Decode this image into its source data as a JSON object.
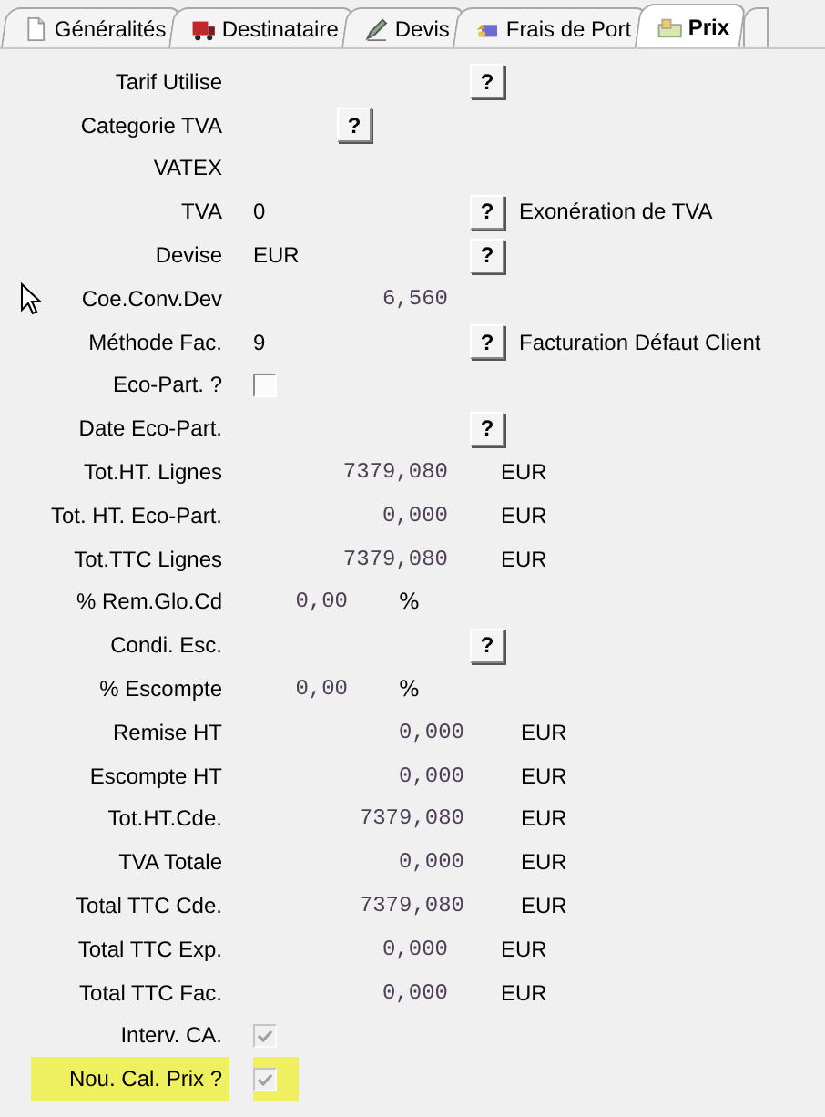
{
  "tabs": [
    {
      "label": "Généralités",
      "selected": false
    },
    {
      "label": "Destinataire",
      "selected": false
    },
    {
      "label": "Devis",
      "selected": false
    },
    {
      "label": "Frais de Port",
      "selected": false
    },
    {
      "label": "Prix",
      "selected": true
    }
  ],
  "fields": [
    {
      "label": "Tarif Utilise",
      "kind": "help",
      "help": "?"
    },
    {
      "label": "Categorie TVA",
      "kind": "help_inline",
      "help": "?"
    },
    {
      "label": "VATEX",
      "kind": "plain"
    },
    {
      "label": "TVA",
      "kind": "help",
      "value": "0",
      "help": "?",
      "description": "Exonération de TVA"
    },
    {
      "label": "Devise",
      "kind": "help",
      "value": "EUR",
      "help": "?"
    },
    {
      "label": "Coe.Conv.Dev",
      "kind": "amount",
      "value": "6,560"
    },
    {
      "label": "Méthode Fac.",
      "kind": "help",
      "value": "9",
      "help": "?",
      "description": "Facturation Défaut Client"
    },
    {
      "label": "Eco-Part. ?",
      "kind": "checkbox",
      "checked": false,
      "disabled": false,
      "highlighted": false
    },
    {
      "label": "Date Eco-Part.",
      "kind": "help",
      "help": "?"
    },
    {
      "label": "Tot.HT.  Lignes",
      "kind": "amount",
      "value": "7379,080",
      "unit": "EUR"
    },
    {
      "label": "Tot. HT. Eco-Part.",
      "kind": "amount",
      "value": "0,000",
      "unit": "EUR"
    },
    {
      "label": "Tot.TTC Lignes",
      "kind": "amount",
      "value": "7379,080",
      "unit": "EUR"
    },
    {
      "label": "% Rem.Glo.Cd",
      "kind": "percent",
      "value": "0,00",
      "unit": "%"
    },
    {
      "label": "Condi. Esc.",
      "kind": "help",
      "help": "?"
    },
    {
      "label": "% Escompte",
      "kind": "percent",
      "value": "0,00",
      "unit": "%"
    },
    {
      "label": "Remise HT",
      "kind": "total",
      "value": "0,000",
      "unit": "EUR"
    },
    {
      "label": "Escompte HT",
      "kind": "total",
      "value": "0,000",
      "unit": "EUR"
    },
    {
      "label": "Tot.HT.Cde.",
      "kind": "total",
      "value": "7379,080",
      "unit": "EUR"
    },
    {
      "label": "TVA Totale",
      "kind": "total",
      "value": "0,000",
      "unit": "EUR"
    },
    {
      "label": "Total TTC Cde.",
      "kind": "total",
      "value": "7379,080",
      "unit": "EUR"
    },
    {
      "label": "Total TTC Exp.",
      "kind": "amount",
      "value": "0,000",
      "unit": "EUR"
    },
    {
      "label": "Total TTC Fac.",
      "kind": "amount",
      "value": "0,000",
      "unit": "EUR"
    },
    {
      "label": "Interv. CA.",
      "kind": "checkbox",
      "checked": true,
      "disabled": true,
      "highlighted": false
    },
    {
      "label": "Nou. Cal. Prix ?",
      "kind": "checkbox",
      "checked": true,
      "disabled": true,
      "highlighted": true
    }
  ]
}
